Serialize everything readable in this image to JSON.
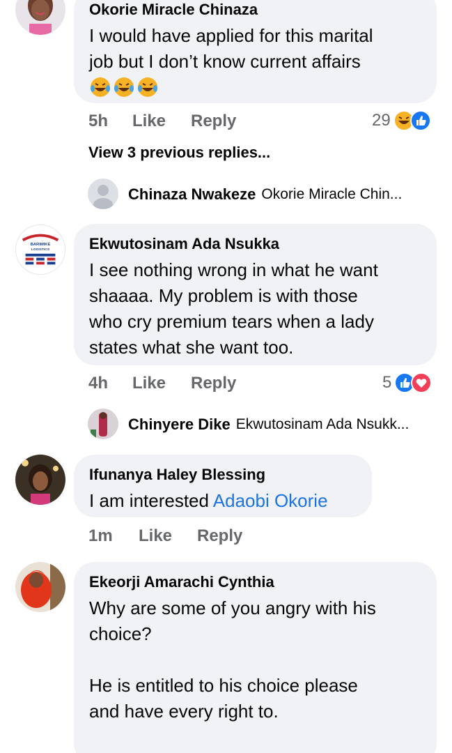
{
  "comments": [
    {
      "author": "Okorie Miracle Chinaza",
      "text_lines": [
        "I would have applied for this marital",
        "job but I don’t know current affairs"
      ],
      "emoji": [
        "laugh-cry",
        "laugh-cry",
        "laugh-cry"
      ],
      "time": "5h",
      "like": "Like",
      "reply": "Reply",
      "reaction_count": "29",
      "reactions": [
        "haha",
        "like"
      ],
      "view_previous": "View 3 previous replies...",
      "latest_reply": {
        "name": "Chinaza Nwakeze",
        "preview": "Okorie Miracle Chin..."
      }
    },
    {
      "author": "Ekwutosinam Ada Nsukka",
      "text_lines": [
        "I see nothing wrong in what he want",
        "shaaaa. My problem is with those",
        "who cry premium tears when a lady",
        "states what she want too."
      ],
      "time": "4h",
      "like": "Like",
      "reply": "Reply",
      "reaction_count": "5",
      "reactions": [
        "like",
        "love"
      ],
      "avatar_logo_text": [
        "BARIMIKE",
        "LOGISTICS"
      ],
      "latest_reply": {
        "name": "Chinyere Dike",
        "preview": "Ekwutosinam Ada Nsukk..."
      }
    },
    {
      "author": "Ifunanya Haley Blessing",
      "text_plain": "I am interested ",
      "mention": "Adaobi Okorie",
      "time": "1m",
      "like": "Like",
      "reply": "Reply"
    },
    {
      "author": "Ekeorji Amarachi Cynthia",
      "text_lines": [
        "Why are some of you angry with his",
        "choice?",
        "",
        "He is entitled to his choice please",
        "and have every right to."
      ]
    }
  ],
  "colors": {
    "bubble": "#f0f2f5",
    "meta": "#65676b",
    "mention": "#1b74e4",
    "like_blue": "#1877f2",
    "love_red": "#f33e58",
    "haha_yellow": "#f7b125"
  }
}
